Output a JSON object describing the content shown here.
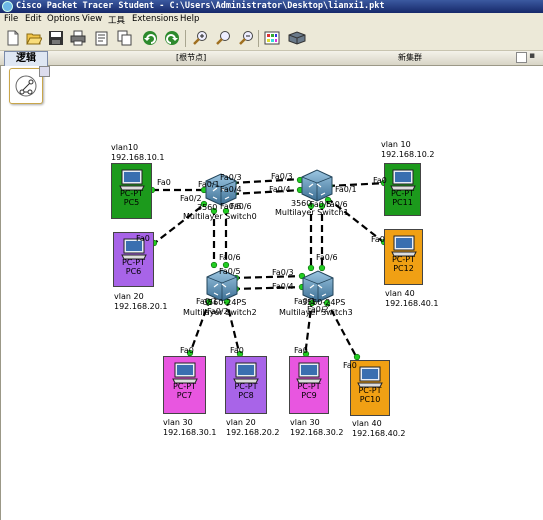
{
  "window": {
    "title": "Cisco Packet Tracer Student - C:\\Users\\Administrator\\Desktop\\lianxi1.pkt"
  },
  "menu": [
    "File",
    "Edit",
    "Options",
    "View",
    "工具",
    "Extensions",
    "Help"
  ],
  "toolbar_icons": [
    "new-icon",
    "open-icon",
    "save-icon",
    "print-icon",
    "activity-wizard-icon",
    "copy-icon",
    "undo-icon",
    "redo-icon",
    "zoom-in-icon",
    "zoom-reset-icon",
    "zoom-out-icon",
    "palette-icon",
    "custom-device-icon"
  ],
  "tabs": {
    "logic": "逻辑",
    "root": "[根节点]",
    "new_cluster": "新集群"
  },
  "pcs": {
    "pc5": {
      "type": "PC-PT",
      "name": "PC5",
      "vlan": "vlan10",
      "ip": "192.168.10.1",
      "port": "Fa0",
      "color": "#1c9a1c"
    },
    "pc11": {
      "type": "PC-PT",
      "name": "PC11",
      "vlan": "vlan 10",
      "ip": "192.168.10.2",
      "port": "Fa0",
      "color": "#1c9a1c"
    },
    "pc6": {
      "type": "PC-PT",
      "name": "PC6",
      "vlan": "vlan 20",
      "ip": "192.168.20.1",
      "port": "Fa0",
      "color": "#a864e8"
    },
    "pc12": {
      "type": "PC-PT",
      "name": "PC12",
      "vlan": "vlan 40",
      "ip": "192.168.40.1",
      "port": "Fa0",
      "color": "#f0a014"
    },
    "pc7": {
      "type": "PC-PT",
      "name": "PC7",
      "vlan": "vlan 30",
      "ip": "192.168.30.1",
      "port": "Fa0",
      "color": "#e856e0"
    },
    "pc8": {
      "type": "PC-PT",
      "name": "PC8",
      "vlan": "vlan 20",
      "ip": "192.168.20.2",
      "port": "Fa0",
      "color": "#a864e8"
    },
    "pc9": {
      "type": "PC-PT",
      "name": "PC9",
      "vlan": "vlan 30",
      "ip": "192.168.30.2",
      "port": "Fa0",
      "color": "#e856e0"
    },
    "pc10": {
      "type": "PC-PT",
      "name": "PC10",
      "vlan": "vlan 40",
      "ip": "192.168.40.2",
      "port": "Fa0",
      "color": "#f0a014"
    }
  },
  "switches": {
    "sw0": {
      "model": "3560",
      "name": "Multilayer Switch0"
    },
    "sw1": {
      "model": "3560",
      "name": "Multilayer Switch1"
    },
    "sw2": {
      "model": "3560-24PS",
      "name": "Multilayer Switch2"
    },
    "sw3": {
      "model": "3560-24PS",
      "name": "Multilayer Switch3"
    }
  },
  "ports": {
    "sw0_fa01": "Fa0/1",
    "sw0_fa02": "Fa0/2",
    "sw0_fa03": "Fa0/3",
    "sw0_fa04": "Fa0/4",
    "sw0_fa05": "Fa0/5",
    "sw0_fa06": "Fa0/6",
    "sw1_fa01": "Fa0/1",
    "sw1_fa02": "Fa0/2",
    "sw1_fa03": "Fa0/3",
    "sw1_fa04": "Fa0/4",
    "sw1_fa05": "Fa0/5",
    "sw1_fa06": "Fa0/6",
    "sw2_fa01": "Fa0/1",
    "sw2_fa02": "Fa0/2",
    "sw2_fa03": "Fa0/3",
    "sw2_fa04": "Fa0/4",
    "sw2_fa05": "Fa0/5",
    "sw2_fa06": "Fa0/6",
    "sw3_fa01": "Fa0/1",
    "sw3_fa02": "Fa0/2",
    "sw3_fa03": "Fa0/3",
    "sw3_fa04": "Fa0/4",
    "sw3_fa05": "Fa0/5",
    "sw3_fa06": "Fa0/6"
  },
  "colors": {
    "link": "#000000",
    "link_up": "#22cc22",
    "switch": "#5b93b8"
  }
}
